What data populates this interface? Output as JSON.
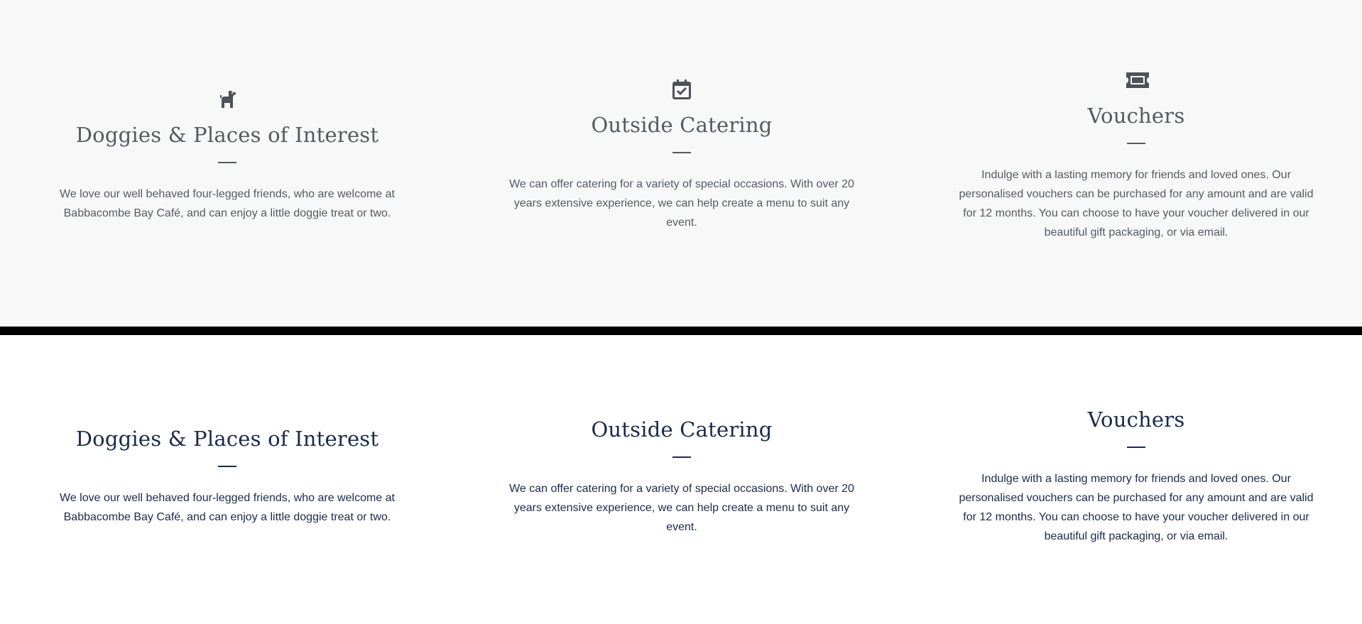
{
  "colors": {
    "top_background": "#f8f8f8",
    "divider": "#000000",
    "bottom_background": "#ffffff",
    "top_text": "#555a60",
    "bottom_text": "#1b2a4a",
    "icon": "#4e535a"
  },
  "top_section": {
    "cards": [
      {
        "icon": "dog-icon",
        "title": "Doggies & Places of Interest",
        "text": "We love our well behaved four-legged friends, who are welcome at Babbacombe Bay Café, and can enjoy a little doggie treat or two."
      },
      {
        "icon": "calendar-check-icon",
        "title": "Outside Catering",
        "text": "We can offer catering for a variety of special occasions. With over 20 years extensive experience, we can help create a menu to suit any event."
      },
      {
        "icon": "ticket-icon",
        "title": "Vouchers",
        "text": "Indulge with a lasting memory for friends and loved ones. Our personalised vouchers can be purchased for any amount and are valid for 12 months. You can choose to have your voucher delivered in our beautiful gift packaging, or via email."
      }
    ]
  },
  "bottom_section": {
    "cards": [
      {
        "title": "Doggies & Places of Interest",
        "text": "We love our well behaved four-legged friends, who are welcome at Babbacombe Bay Café, and can enjoy a little doggie treat or two."
      },
      {
        "title": "Outside Catering",
        "text": "We can offer catering for a variety of special occasions. With over 20 years extensive experience, we can help create a menu to suit any event."
      },
      {
        "title": "Vouchers",
        "text": "Indulge with a lasting memory for friends and loved ones. Our personalised vouchers can be purchased for any amount and are valid for 12 months. You can choose to have your voucher delivered in our beautiful gift packaging, or via email."
      }
    ]
  }
}
